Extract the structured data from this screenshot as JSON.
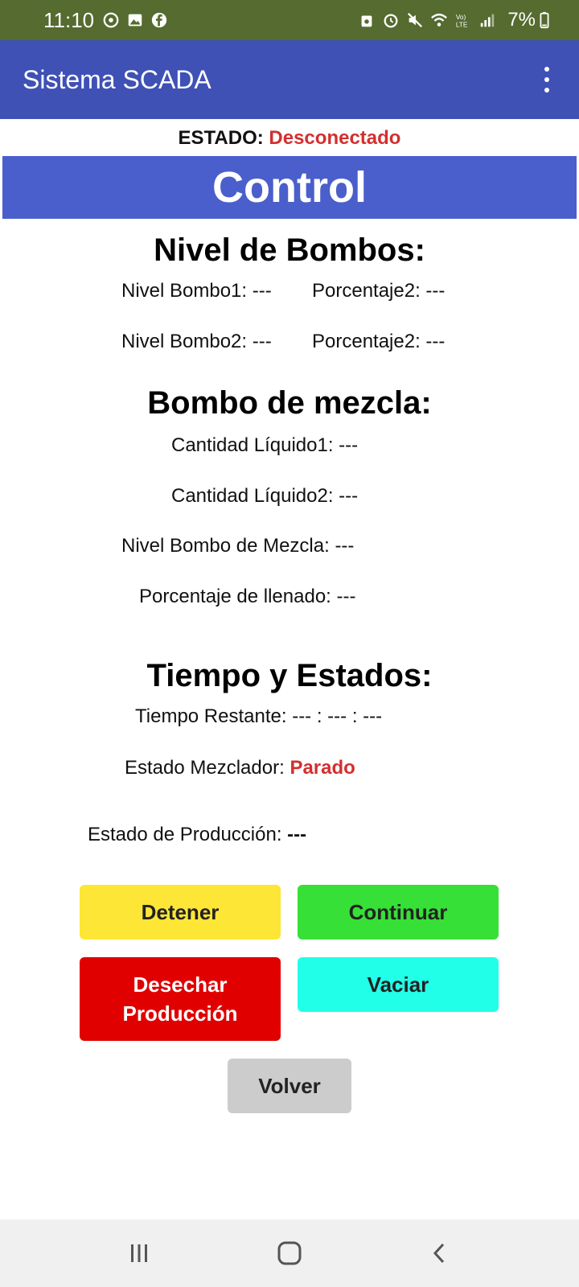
{
  "status_bar": {
    "time": "11:10",
    "battery": "7%",
    "icons": [
      "whatsapp-icon",
      "gallery-icon",
      "facebook-icon",
      "android-icon",
      "alarm-icon",
      "mute-icon",
      "wifi-icon",
      "volte-icon",
      "signal-icon",
      "battery-icon"
    ]
  },
  "app_bar": {
    "title": "Sistema SCADA"
  },
  "estado": {
    "label": "ESTADO: ",
    "value": "Desconectado"
  },
  "banner": "Control",
  "nivel_bombos": {
    "title": "Nivel de Bombos:",
    "nivel1": "Nivel Bombo1: ---",
    "porcentaje1": "Porcentaje2: ---",
    "nivel2": "Nivel Bombo2: ---",
    "porcentaje2": "Porcentaje2: ---"
  },
  "bombo_mezcla": {
    "title": "Bombo de mezcla:",
    "liquido1": "Cantidad Líquido1: ---",
    "liquido2": "Cantidad Líquido2: ---",
    "nivel_mezcla": "Nivel Bombo de Mezcla: ---",
    "porcentaje_llenado": "Porcentaje de llenado: ---"
  },
  "tiempo_estados": {
    "title": "Tiempo y Estados:",
    "tiempo_restante": "Tiempo Restante: --- : --- : ---",
    "estado_mezclador_label": "Estado Mezclador: ",
    "estado_mezclador_value": "Parado",
    "estado_produccion_label": "Estado de Producción: ",
    "estado_produccion_value": "---"
  },
  "buttons": {
    "detener": "Detener",
    "continuar": "Continuar",
    "desechar": "Desechar\nProducción",
    "vaciar": "Vaciar",
    "volver": "Volver"
  },
  "colors": {
    "status_bar": "#556b2f",
    "app_bar": "#3f51b5",
    "banner": "#4a5fcb",
    "alert_red": "#d32f2f",
    "detener": "#fde636",
    "continuar": "#36e036",
    "desechar": "#e00000",
    "vaciar": "#22ffe8",
    "volver": "#cccccc"
  }
}
